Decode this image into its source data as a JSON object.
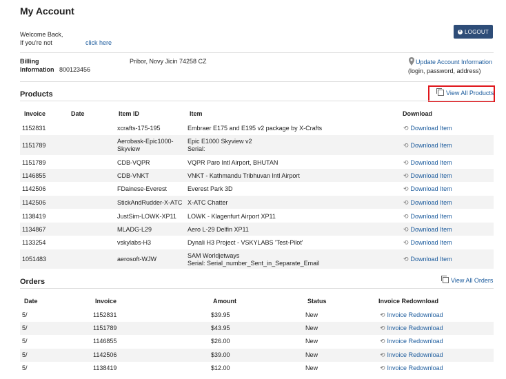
{
  "page": {
    "title": "My Account"
  },
  "welcome": {
    "line1": "Welcome Back,",
    "line2": "If you're not",
    "click_here": "click here"
  },
  "logout": {
    "label": "LOGOUT"
  },
  "billing": {
    "label1": "Billing",
    "label2": "Information",
    "number": "800123456",
    "address": "Pribor, Novy Jicin 74258 CZ",
    "update_link": "Update Account Information",
    "update_sub": "(login, password, address)"
  },
  "products": {
    "title": "Products",
    "view_all": "View All Products",
    "headers": {
      "invoice": "Invoice",
      "date": "Date",
      "item_id": "Item ID",
      "item": "Item",
      "download": "Download"
    },
    "download_label": "Download Item",
    "rows": [
      {
        "invoice": "1152831",
        "item_id": "xcrafts-175-195",
        "item_id2": "",
        "item": "Embraer E175 and E195 v2 package by X-Crafts",
        "item2": ""
      },
      {
        "invoice": "1151789",
        "item_id": "Aerobask-Epic1000-",
        "item_id2": "Skyview",
        "item": "Epic E1000 Skyview v2",
        "item2": "Serial:"
      },
      {
        "invoice": "1151789",
        "item_id": "CDB-VQPR",
        "item_id2": "",
        "item": "VQPR Paro Intl Airport, BHUTAN",
        "item2": ""
      },
      {
        "invoice": "1146855",
        "item_id": "CDB-VNKT",
        "item_id2": "",
        "item": "VNKT - Kathmandu Tribhuvan Intl Airport",
        "item2": ""
      },
      {
        "invoice": "1142506",
        "item_id": "FDainese-Everest",
        "item_id2": "",
        "item": "Everest Park 3D",
        "item2": ""
      },
      {
        "invoice": "1142506",
        "item_id": "StickAndRudder-X-ATC",
        "item_id2": "",
        "item": "X-ATC Chatter",
        "item2": ""
      },
      {
        "invoice": "1138419",
        "item_id": "JustSim-LOWK-XP11",
        "item_id2": "",
        "item": "LOWK - Klagenfurt Airport XP11",
        "item2": ""
      },
      {
        "invoice": "1134867",
        "item_id": "MLADG-L29",
        "item_id2": "",
        "item": "Aero L-29 Delfin XP11",
        "item2": ""
      },
      {
        "invoice": "1133254",
        "item_id": "vskylabs-H3",
        "item_id2": "",
        "item": "Dynali H3 Project - VSKYLABS 'Test-Pilot'",
        "item2": ""
      },
      {
        "invoice": "1051483",
        "item_id": "aerosoft-WJW",
        "item_id2": "",
        "item": "SAM Worldjetways",
        "item2": "Serial: Serial_number_Sent_in_Separate_Email"
      }
    ]
  },
  "orders": {
    "title": "Orders",
    "view_all": "View All Orders",
    "headers": {
      "date": "Date",
      "invoice": "Invoice",
      "amount": "Amount",
      "status": "Status",
      "redownload": "Invoice Redownload"
    },
    "redownload_label": "Invoice Redownload",
    "rows": [
      {
        "date": "5/",
        "invoice": "1152831",
        "amount": "$39.95",
        "status": "New"
      },
      {
        "date": "5/",
        "invoice": "1151789",
        "amount": "$43.95",
        "status": "New"
      },
      {
        "date": "5/",
        "invoice": "1146855",
        "amount": "$26.00",
        "status": "New"
      },
      {
        "date": "5/",
        "invoice": "1142506",
        "amount": "$39.00",
        "status": "New"
      },
      {
        "date": "5/",
        "invoice": "1138419",
        "amount": "$12.00",
        "status": "New"
      }
    ]
  },
  "colors": {
    "highlight": "#e0161b",
    "button": "#2e4d78",
    "link": "#1a5a9c"
  }
}
